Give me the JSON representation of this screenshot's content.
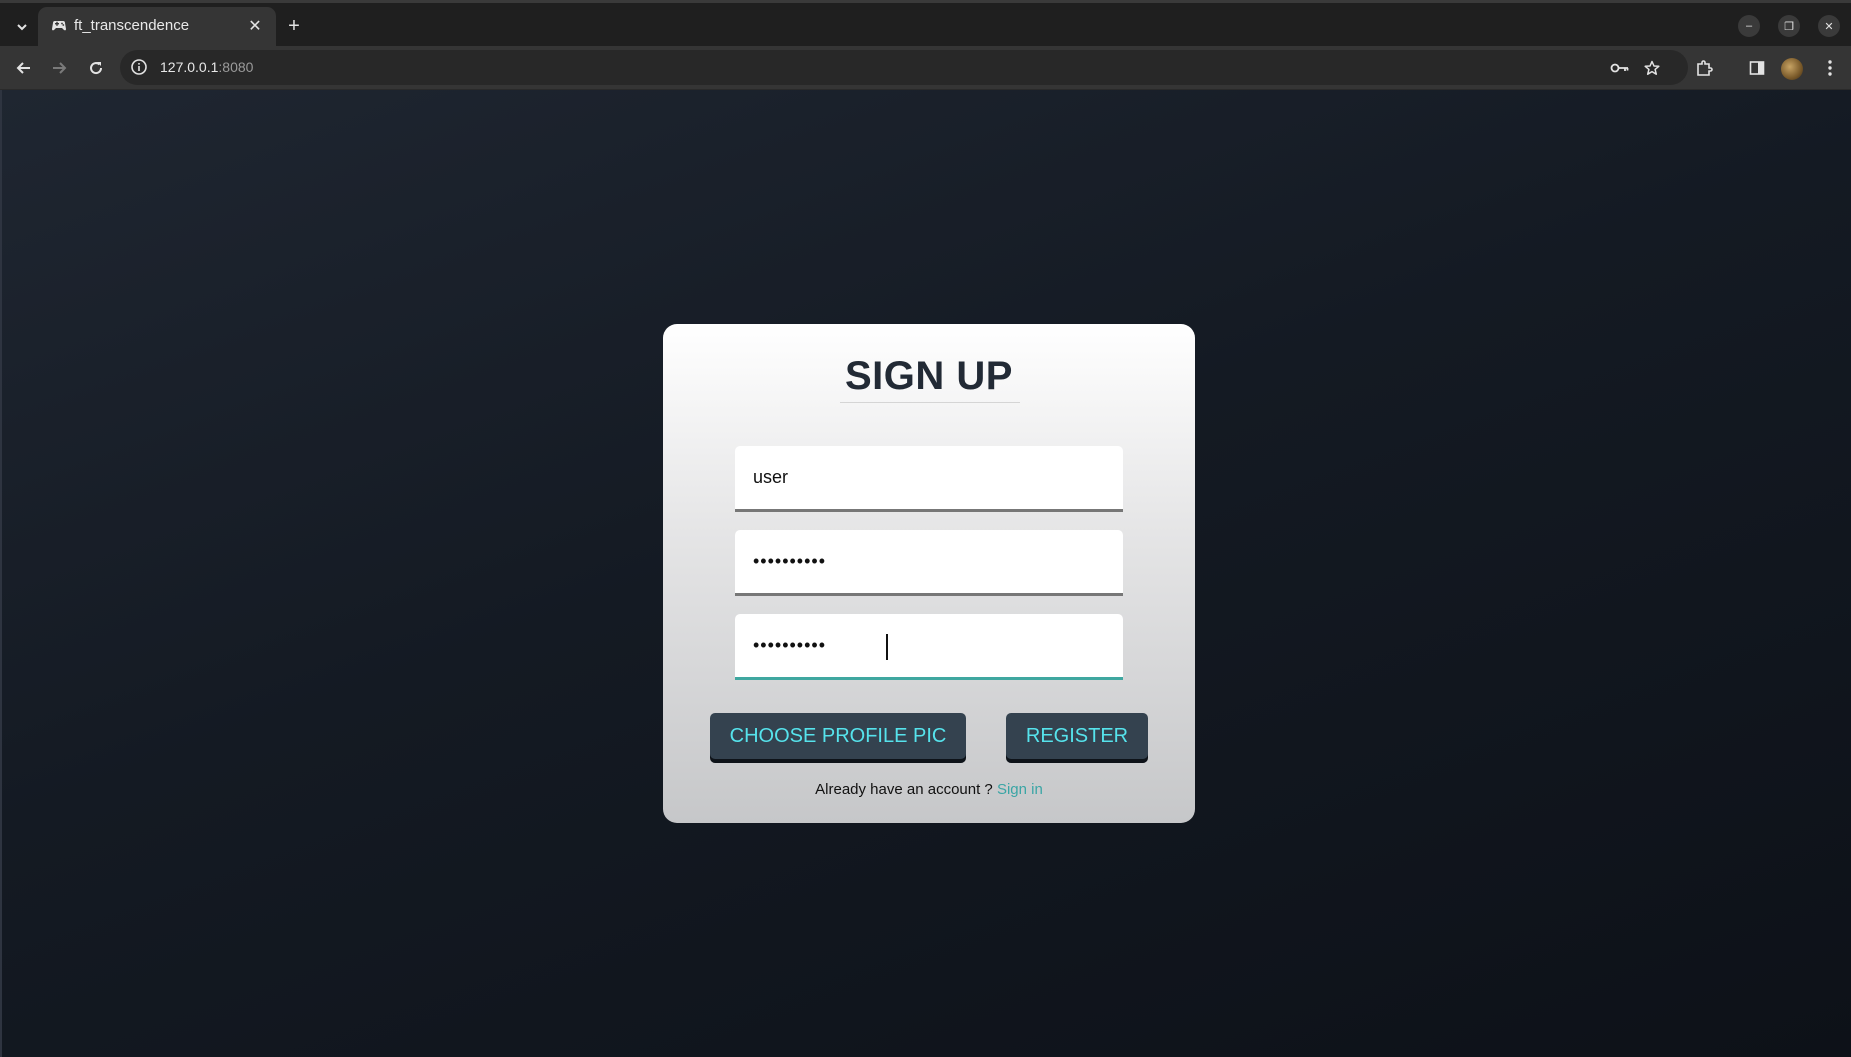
{
  "browser": {
    "tab": {
      "title": "ft_transcendence",
      "favicon": "gamepad-icon",
      "close_glyph": "✕"
    },
    "new_tab_glyph": "+",
    "tab_list_glyph": "⌄",
    "window_controls": {
      "minimize": "–",
      "restore": "❐",
      "close": "✕"
    },
    "address_bar": {
      "host": "127.0.0.1",
      "port": ":8080"
    },
    "icons": {
      "back": "arrow-left-icon",
      "forward": "arrow-right-icon",
      "reload": "reload-icon",
      "info": "info-icon",
      "key": "key-icon",
      "bookmark": "star-icon",
      "extensions": "puzzle-icon",
      "side_panel": "side-panel-icon",
      "menu": "kebab-menu-icon"
    }
  },
  "signup": {
    "title": "SIGN UP",
    "username_value": "user",
    "password_value": "••••••••••",
    "confirm_password_value": "••••••••••",
    "choose_pic_label": "CHOOSE PROFILE PIC",
    "register_label": "REGISTER",
    "footer_prefix": "Already have an account ? ",
    "signin_link": "Sign in"
  },
  "colors": {
    "accent": "#56e3ec",
    "link": "#3aa5a5",
    "button_bg": "#34424f",
    "title": "#222a35"
  }
}
